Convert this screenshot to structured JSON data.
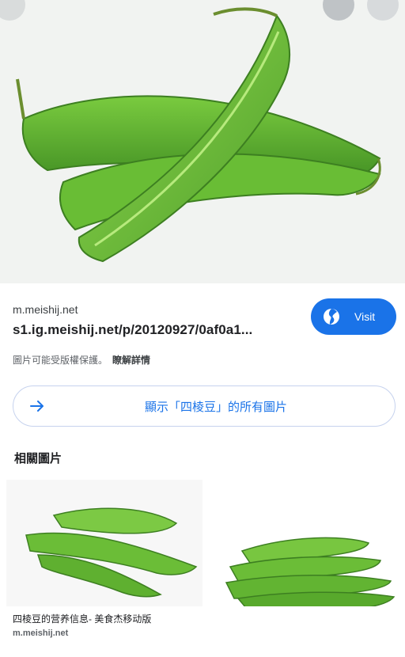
{
  "result": {
    "domain": "m.meishij.net",
    "url": "s1.ig.meishij.net/p/20120927/0af0a1...",
    "visit_label": "Visit",
    "copyright_text": "圖片可能受版權保護。",
    "learn_more": "瞭解詳情"
  },
  "show_all_label": "顯示「四棱豆」的所有圖片",
  "related": {
    "title": "相關圖片",
    "items": [
      {
        "title": "四棱豆的营养信息- 美食杰移动版",
        "source": "m.meishij.net"
      },
      {
        "title": "",
        "source": ""
      }
    ]
  },
  "colors": {
    "accent": "#1a73e8",
    "bean_green": "#6cc33a"
  },
  "icons": [
    "globe-icon",
    "arrow-right-icon"
  ]
}
